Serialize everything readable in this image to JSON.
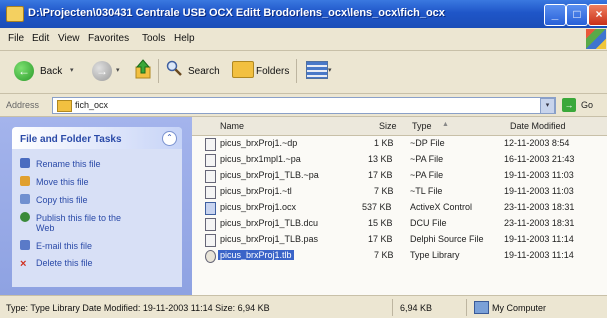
{
  "window": {
    "title": "D:\\Projecten\\030431 Centrale USB OCX Editt Brodorlens_ocx\\lens_ocx\\fich_ocx",
    "title_icon": "folder-icon",
    "controls": {
      "minimize": "_",
      "maximize": "□",
      "close": "×"
    }
  },
  "menu": {
    "items": [
      "File",
      "Edit",
      "View",
      "Favorites",
      "Tools",
      "Help"
    ]
  },
  "toolbar": {
    "back_label": "Back",
    "search_label": "Search",
    "folders_label": "Folders",
    "dropdown_glyph": "▾"
  },
  "address": {
    "label": "Address",
    "value": "fich_ocx",
    "go_label": "Go",
    "go_glyph": "→",
    "drop_glyph": "▾"
  },
  "tasks": {
    "header": "File and Folder Tasks",
    "collapse_glyph": "⌃",
    "items": [
      {
        "label": "Rename this file",
        "icon": "rename-icon",
        "color": "#4a6cc0"
      },
      {
        "label": "Move this file",
        "icon": "move-icon",
        "color": "#e0a030"
      },
      {
        "label": "Copy this file",
        "icon": "copy-icon",
        "color": "#7090d0"
      },
      {
        "label": "Publish this file to the",
        "label2": "Web",
        "icon": "publish-web-icon",
        "color": "#3a8a3a"
      },
      {
        "label": "E-mail this file",
        "icon": "email-icon",
        "color": "#5a7ac8"
      },
      {
        "label": "Delete this file",
        "icon": "delete-icon",
        "color": "#d03020"
      }
    ]
  },
  "filelist": {
    "columns": {
      "name": "Name",
      "size": "Size",
      "type": "Type",
      "modified": "Date Modified"
    },
    "sort_glyph": "▲",
    "rows": [
      {
        "name": "picus_brxProj1.~dp",
        "size": "1 KB",
        "type": "~DP File",
        "modified": "12-11-2003 8:54",
        "icon": "file-icon"
      },
      {
        "name": "picus_brx1mpl1.~pa",
        "size": "13 KB",
        "type": "~PA File",
        "modified": "16-11-2003 21:43",
        "icon": "file-icon"
      },
      {
        "name": "picus_brxProj1_TLB.~pa",
        "size": "17 KB",
        "type": "~PA File",
        "modified": "19-11-2003 11:03",
        "icon": "file-icon"
      },
      {
        "name": "picus_brxProj1.~tl",
        "size": "7 KB",
        "type": "~TL File",
        "modified": "19-11-2003 11:03",
        "icon": "file-icon"
      },
      {
        "name": "picus_brxProj1.ocx",
        "size": "537 KB",
        "type": "ActiveX Control",
        "modified": "23-11-2003 18:31",
        "icon": "activex-icon"
      },
      {
        "name": "picus_brxProj1_TLB.dcu",
        "size": "15 KB",
        "type": "DCU File",
        "modified": "23-11-2003 18:31",
        "icon": "file-icon"
      },
      {
        "name": "picus_brxProj1_TLB.pas",
        "size": "17 KB",
        "type": "Delphi Source File",
        "modified": "19-11-2003 11:14",
        "icon": "file-icon"
      },
      {
        "name": "picus_brxProj1.tlb",
        "size": "7 KB",
        "type": "Type Library",
        "modified": "19-11-2003 11:14",
        "icon": "type-library-icon",
        "selected": true
      }
    ]
  },
  "status": {
    "text": "Type: Type Library Date Modified: 19-11-2003 11:14 Size: 6,94 KB",
    "size": "6,94 KB",
    "location": "My Computer"
  },
  "colors": {
    "titlebar": "#1f56c8",
    "task_pane": "#8ea2e2",
    "selection": "#3a64c8"
  }
}
